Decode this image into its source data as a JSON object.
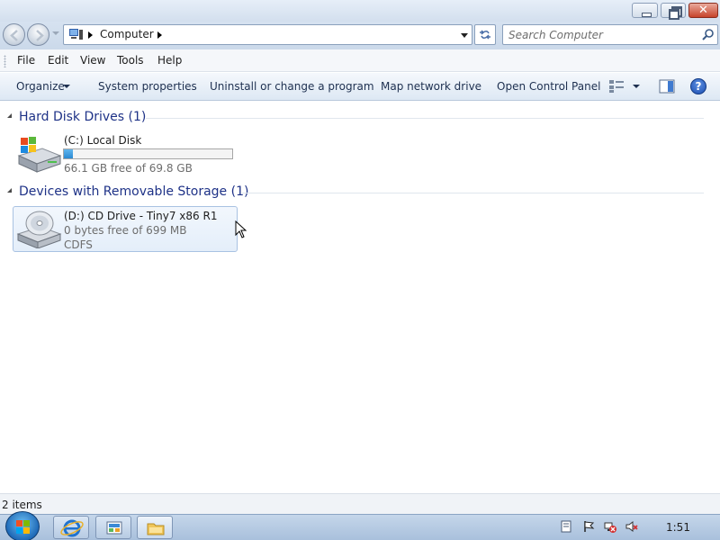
{
  "titlebar": {
    "minimize_icon": "minimize-icon",
    "restore_icon": "restore-icon",
    "close_icon": "close-icon",
    "close_glyph": "✕"
  },
  "address": {
    "crumb": "Computer",
    "search_placeholder": "Search Computer"
  },
  "menu": {
    "file": "File",
    "edit": "Edit",
    "view": "View",
    "tools": "Tools",
    "help": "Help"
  },
  "commands": {
    "organize": "Organize",
    "system_properties": "System properties",
    "uninstall": "Uninstall or change a program",
    "map_drive": "Map network drive",
    "open_control_panel": "Open Control Panel",
    "help_glyph": "?"
  },
  "groups": [
    {
      "header": "Hard Disk Drives (1)",
      "drives": [
        {
          "name": "(C:) Local Disk",
          "free_text": "66.1 GB free of 69.8 GB",
          "used_fraction": 0.053,
          "icon": "hard-drive-icon"
        }
      ]
    },
    {
      "header": "Devices with Removable Storage (1)",
      "drives": [
        {
          "name": "(D:) CD Drive - Tiny7 x86 R1",
          "free_text": "0 bytes free of 699 MB",
          "filesystem": "CDFS",
          "icon": "cd-drive-icon"
        }
      ]
    }
  ],
  "status": {
    "item_count": "2 items"
  },
  "taskbar": {
    "clock": "1:51"
  },
  "colors": {
    "group_header": "#1e3287",
    "selection_border": "#a9c2e2",
    "disk_bar_fill": "#2b8ad2"
  }
}
